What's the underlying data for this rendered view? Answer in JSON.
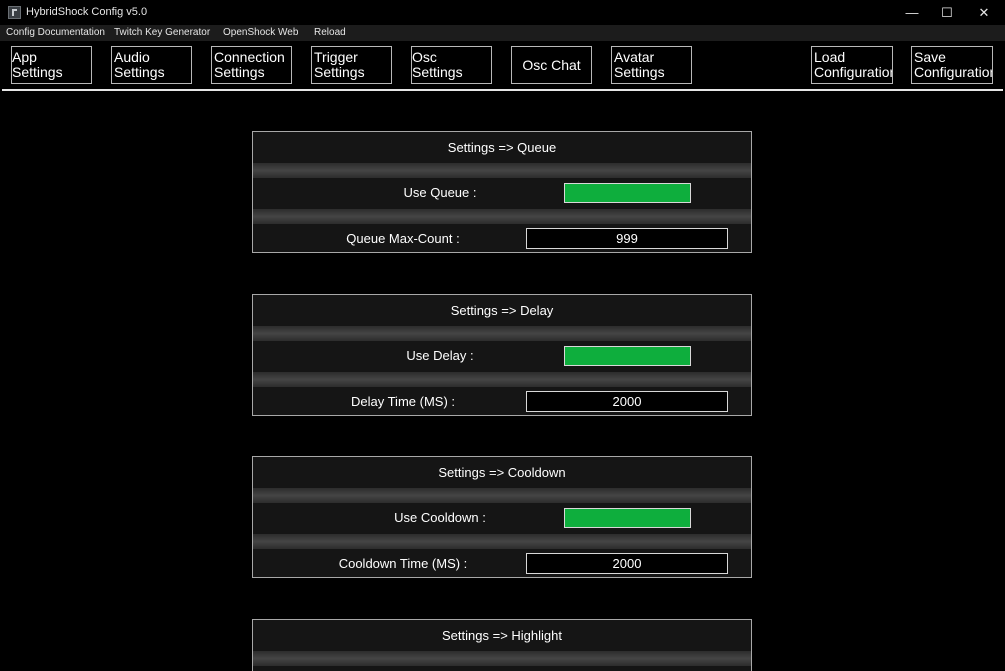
{
  "window": {
    "title": "HybridShock Config v5.0",
    "minimize_glyph": "—",
    "maximize_glyph": "☐",
    "close_glyph": "✕"
  },
  "menu": {
    "items": [
      "Config Documentation",
      "Twitch Key Generator",
      "OpenShock Web",
      "Reload"
    ]
  },
  "toolbar": {
    "buttons": [
      {
        "label": "App Settings"
      },
      {
        "label": "Audio\nSettings"
      },
      {
        "label": "Connection\nSettings"
      },
      {
        "label": "Trigger\nSettings"
      },
      {
        "label": "Osc Settings"
      },
      {
        "label": "Osc Chat"
      },
      {
        "label": "Avatar\nSettings"
      },
      {
        "label": "Load\nConfiguration"
      },
      {
        "label": "Save\nConfiguration"
      }
    ]
  },
  "panels": [
    {
      "title": "Settings => Queue",
      "toggle_label": "Use Queue :",
      "toggle_on": true,
      "value_label": "Queue Max-Count :",
      "value": "999"
    },
    {
      "title": "Settings => Delay",
      "toggle_label": "Use Delay :",
      "toggle_on": true,
      "value_label": "Delay Time (MS) :",
      "value": "2000"
    },
    {
      "title": "Settings => Cooldown",
      "toggle_label": "Use Cooldown :",
      "toggle_on": true,
      "value_label": "Cooldown Time (MS) :",
      "value": "2000"
    },
    {
      "title": "Settings => Highlight"
    }
  ],
  "colors": {
    "toggle_on": "#0eae3d",
    "background": "#000000",
    "panel": "#151515"
  }
}
